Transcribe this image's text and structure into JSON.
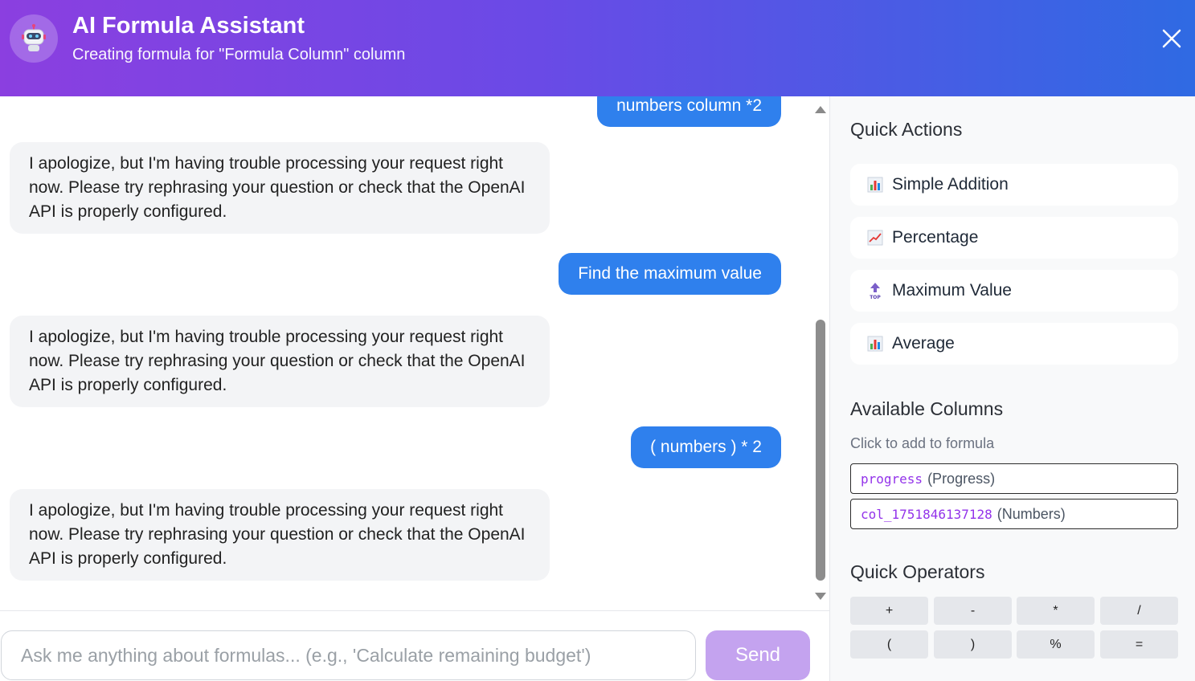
{
  "header": {
    "title": "AI Formula Assistant",
    "subtitle": "Creating formula for \"Formula Column\" column"
  },
  "messages": [
    {
      "role": "user",
      "text": "numbers column *2"
    },
    {
      "role": "bot",
      "text": "I apologize, but I'm having trouble processing your request right now. Please try rephrasing your question or check that the OpenAI API is properly configured."
    },
    {
      "role": "user",
      "text": "Find the maximum value"
    },
    {
      "role": "bot",
      "text": "I apologize, but I'm having trouble processing your request right now. Please try rephrasing your question or check that the OpenAI API is properly configured."
    },
    {
      "role": "user",
      "text": "( numbers ) * 2"
    },
    {
      "role": "bot",
      "text": "I apologize, but I'm having trouble processing your request right now. Please try rephrasing your question or check that the OpenAI API is properly configured."
    }
  ],
  "input": {
    "placeholder": "Ask me anything about formulas... (e.g., 'Calculate remaining budget')",
    "send_label": "Send"
  },
  "panel": {
    "quick_actions_title": "Quick Actions",
    "quick_actions": [
      {
        "label": "Simple Addition",
        "icon": "bar-chart-icon"
      },
      {
        "label": "Percentage",
        "icon": "trend-up-icon"
      },
      {
        "label": "Maximum Value",
        "icon": "top-arrow-icon"
      },
      {
        "label": "Average",
        "icon": "bar-chart-icon"
      }
    ],
    "columns_title": "Available Columns",
    "columns_hint": "Click to add to formula",
    "columns": [
      {
        "key": "progress",
        "name": "(Progress)"
      },
      {
        "key": "col_1751846137128",
        "name": "(Numbers)"
      }
    ],
    "operators_title": "Quick Operators",
    "operators": [
      "+",
      "-",
      "*",
      "/",
      "(",
      ")",
      "%",
      "="
    ]
  },
  "colors": {
    "user_bubble": "#2f80ed",
    "bot_bubble": "#f3f4f6",
    "send_button": "#c4a3ef",
    "column_key": "#9333ea"
  }
}
